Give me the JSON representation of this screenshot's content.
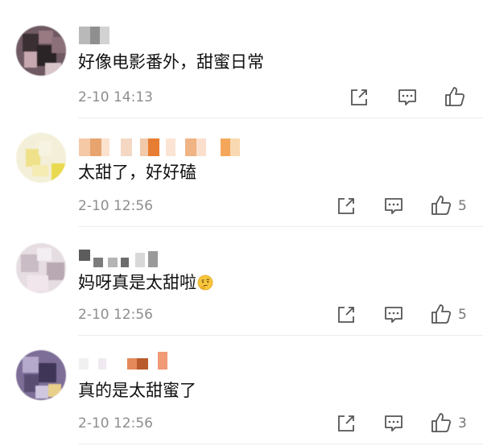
{
  "comments": [
    {
      "text": "好像电影番外，甜蜜日常",
      "time": "2-10 14:13",
      "likes": ""
    },
    {
      "text": "太甜了，好好磕",
      "time": "2-10 12:56",
      "likes": "5"
    },
    {
      "text": "妈呀真是太甜啦",
      "time": "2-10 12:56",
      "likes": "5",
      "emoji": "thinking-face"
    },
    {
      "text": "真的是太甜蜜了",
      "time": "2-10 12:56",
      "likes": "3"
    }
  ],
  "icons": {
    "share": "share-icon",
    "comment": "comment-icon",
    "like": "like-icon"
  },
  "colors": {
    "text": "#111111",
    "meta": "#8d8d8d",
    "icon": "#555555",
    "divider": "#ececec"
  }
}
